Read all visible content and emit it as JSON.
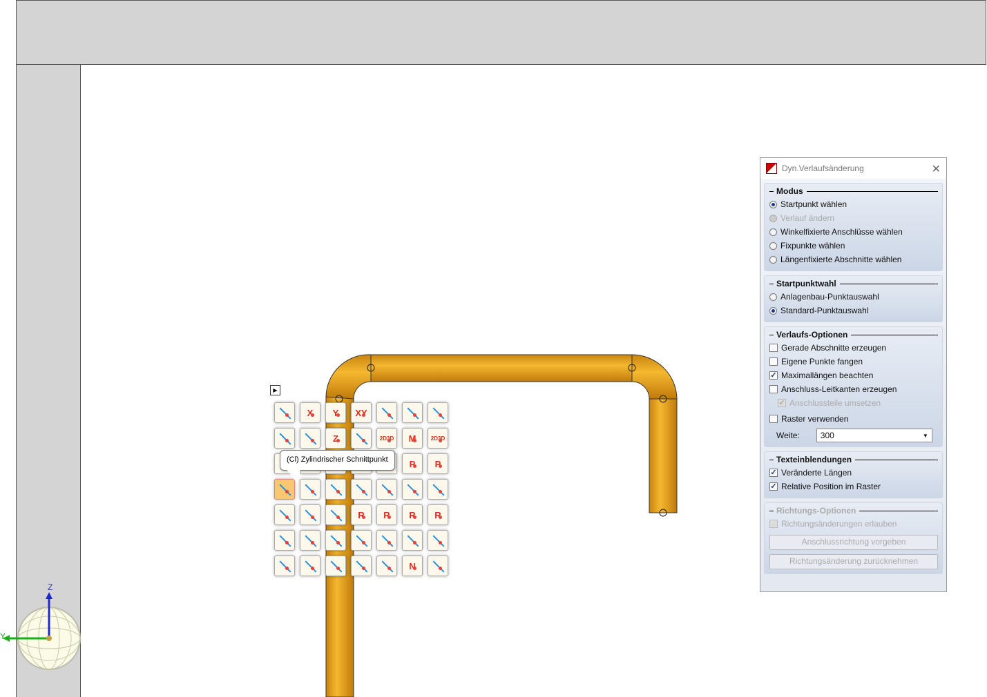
{
  "toolbox": {
    "tooltip": "(Cl) Zylindrischer Schnittpunkt",
    "pin_icon": "pin-toggle-icon",
    "icons": [
      {
        "name": "point-on-line",
        "glyph": ""
      },
      {
        "name": "x-coordinate",
        "glyph": "X"
      },
      {
        "name": "y-coordinate",
        "glyph": "Y"
      },
      {
        "name": "xy-coordinate",
        "glyph": "XY"
      },
      {
        "name": "axes-point",
        "glyph": ""
      },
      {
        "name": "axes-point-2",
        "glyph": ""
      },
      {
        "name": "line-points",
        "glyph": ""
      },
      {
        "name": "circle-point",
        "glyph": ""
      },
      {
        "name": "line-offset",
        "glyph": ""
      },
      {
        "name": "z-coordinate",
        "glyph": "Z"
      },
      {
        "name": "center-arrows",
        "glyph": ""
      },
      {
        "name": "intersection-2d3d",
        "glyph": "2D3D"
      },
      {
        "name": "midpoint",
        "glyph": "M"
      },
      {
        "name": "point-2d3d",
        "glyph": "2D3D"
      },
      {
        "name": "arc-point",
        "glyph": ""
      },
      {
        "name": "hidden-1",
        "glyph": ""
      },
      {
        "name": "hidden-2",
        "glyph": ""
      },
      {
        "name": "hidden-3",
        "glyph": ""
      },
      {
        "name": "hidden-4",
        "glyph": ""
      },
      {
        "name": "polar-x",
        "glyph": "P"
      },
      {
        "name": "polar-y",
        "glyph": "P"
      },
      {
        "name": "cylindrical-intersection",
        "glyph": ""
      },
      {
        "name": "circle-tangent",
        "glyph": ""
      },
      {
        "name": "arc-points",
        "glyph": ""
      },
      {
        "name": "cursor-point",
        "glyph": ""
      },
      {
        "name": "line-intersection",
        "glyph": ""
      },
      {
        "name": "angle-point",
        "glyph": ""
      },
      {
        "name": "zoom-point",
        "glyph": ""
      },
      {
        "name": "plane-projection",
        "glyph": ""
      },
      {
        "name": "cube-center",
        "glyph": ""
      },
      {
        "name": "solid-center",
        "glyph": ""
      },
      {
        "name": "relative-point",
        "glyph": "R"
      },
      {
        "name": "relative-polar",
        "glyph": "R"
      },
      {
        "name": "relative-polar-x",
        "glyph": "R"
      },
      {
        "name": "relative-polar-y",
        "glyph": "R"
      },
      {
        "name": "angle-line",
        "glyph": ""
      },
      {
        "name": "angle-line-2",
        "glyph": ""
      },
      {
        "name": "between-points",
        "glyph": ""
      },
      {
        "name": "calculator",
        "glyph": ""
      },
      {
        "name": "face-point",
        "glyph": ""
      },
      {
        "name": "circle-center",
        "glyph": ""
      },
      {
        "name": "circle-quadrants",
        "glyph": ""
      },
      {
        "name": "point-list",
        "glyph": ""
      },
      {
        "name": "dimension-point",
        "glyph": ""
      },
      {
        "name": "plane-point",
        "glyph": ""
      },
      {
        "name": "crosshair-doc",
        "glyph": ""
      },
      {
        "name": "plane-intersection",
        "glyph": ""
      },
      {
        "name": "north-point",
        "glyph": "N"
      },
      {
        "name": "ellipse-point",
        "glyph": ""
      }
    ]
  },
  "dialog": {
    "title": "Dyn.Verlaufsänderung",
    "modus": {
      "label": "Modus",
      "options": [
        {
          "label": "Startpunkt wählen",
          "selected": true,
          "disabled": false
        },
        {
          "label": "Verlauf ändern",
          "selected": false,
          "disabled": true
        },
        {
          "label": "Winkelfixierte Anschlüsse wählen",
          "selected": false,
          "disabled": false
        },
        {
          "label": "Fixpunkte wählen",
          "selected": false,
          "disabled": false
        },
        {
          "label": "Längenfixierte Abschnitte wählen",
          "selected": false,
          "disabled": false
        }
      ]
    },
    "startpunkt": {
      "label": "Startpunktwahl",
      "options": [
        {
          "label": "Anlagenbau-Punktauswahl",
          "selected": false
        },
        {
          "label": "Standard-Punktauswahl",
          "selected": true
        }
      ]
    },
    "verlauf": {
      "label": "Verlaufs-Optionen",
      "options": [
        {
          "label": "Gerade Abschnitte erzeugen",
          "checked": false
        },
        {
          "label": "Eigene Punkte fangen",
          "checked": false
        },
        {
          "label": "Maximallängen beachten",
          "checked": true
        },
        {
          "label": "Anschluss-Leitkanten erzeugen",
          "checked": false
        },
        {
          "label": "Anschlussteile umsetzen",
          "checked": true,
          "disabled": true
        },
        {
          "label": "Raster verwenden",
          "checked": false
        }
      ],
      "weite_label": "Weite:",
      "weite_value": "300"
    },
    "text": {
      "label": "Texteinblendungen",
      "options": [
        {
          "label": "Veränderte Längen",
          "checked": true
        },
        {
          "label": "Relative Position im Raster",
          "checked": true
        }
      ]
    },
    "richtung": {
      "label": "Richtungs-Optionen",
      "option": "Richtungsänderungen erlauben",
      "btn1": "Anschlussrichtung vorgeben",
      "btn2": "Richtungsänderung zurücknehmen"
    }
  },
  "gizmo": {
    "z": "Z",
    "y": "Y"
  },
  "colors": {
    "pipe": "#e8a020",
    "accent": "#1a3a8a"
  }
}
